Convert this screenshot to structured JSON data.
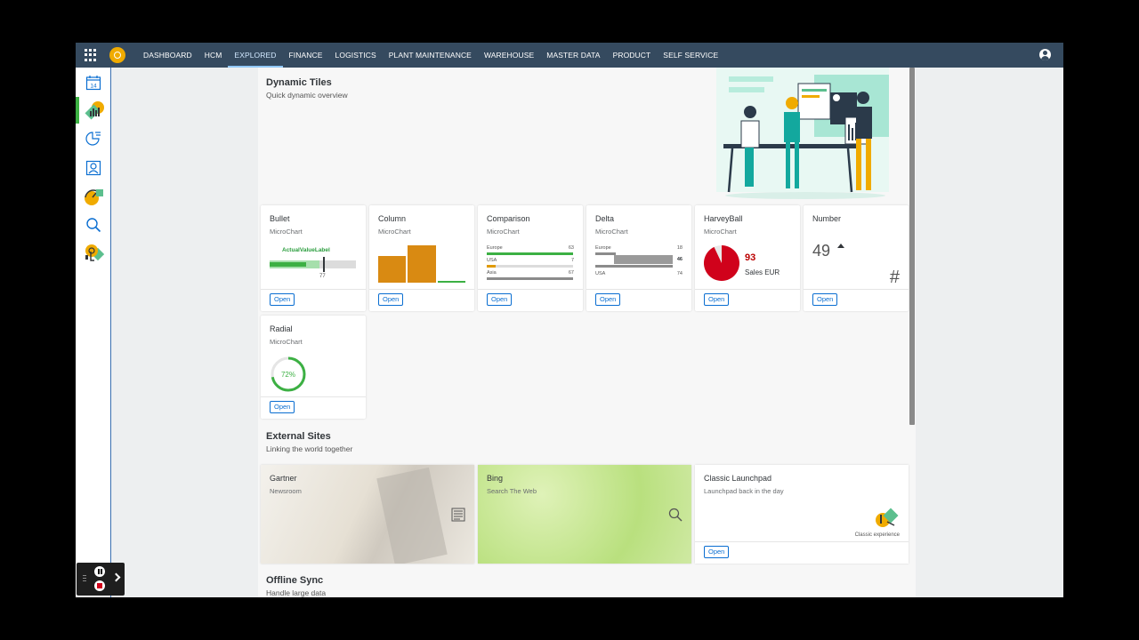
{
  "shellbar": {
    "menu": [
      "DASHBOARD",
      "HCM",
      "EXPLORED",
      "FINANCE",
      "LOGISTICS",
      "PLANT MAINTENANCE",
      "WAREHOUSE",
      "MASTER DATA",
      "PRODUCT",
      "SELF SERVICE"
    ],
    "active": "EXPLORED"
  },
  "sidenav": {
    "calendar_day": "14",
    "items": [
      "calendar-icon",
      "chart-badge-icon",
      "pie-list-icon",
      "user-card-icon",
      "gauge-icon",
      "search-icon",
      "touch-icon"
    ]
  },
  "dynamic": {
    "title": "Dynamic Tiles",
    "subtitle": "Quick dynamic overview"
  },
  "tiles": {
    "open": "Open",
    "microchart": "MicroChart",
    "bullet": {
      "title": "Bullet",
      "label": "ActualValueLabel",
      "target": "77",
      "actual_fraction": 0.42,
      "target_fraction": 0.62
    },
    "column": {
      "title": "Column"
    },
    "comparison": {
      "title": "Comparison",
      "rows": [
        {
          "label": "Europe",
          "value": "63",
          "color": "#3cb043"
        },
        {
          "label": "USA",
          "value": "7",
          "color": "#e09a00"
        },
        {
          "label": "Asia",
          "value": "67",
          "color": "#8b8b8b"
        }
      ]
    },
    "delta": {
      "title": "Delta",
      "top_label": "Europe",
      "top_value": "18",
      "delta_value": "46",
      "bottom_label": "USA",
      "bottom_value": "74"
    },
    "harveyball": {
      "title": "HarveyBall",
      "value": "93",
      "unit": "Sales EUR",
      "fraction": 0.93
    },
    "number": {
      "title": "Number",
      "value": "49",
      "symbol": "#"
    },
    "radial": {
      "title": "Radial",
      "value": "72%",
      "fraction": 0.72
    }
  },
  "external": {
    "title": "External Sites",
    "subtitle": "Linking the world together",
    "gartner": {
      "title": "Gartner",
      "sub": "Newsroom"
    },
    "bing": {
      "title": "Bing",
      "sub": "Search The Web"
    },
    "classic": {
      "title": "Classic Launchpad",
      "sub": "Launchpad back in the day",
      "caption": "Classic experience",
      "open": "Open"
    }
  },
  "offline": {
    "title": "Offline Sync",
    "subtitle": "Handle large data"
  },
  "colors": {
    "shell": "#354a5f",
    "brand": "#0a6ed1",
    "green": "#3cb043",
    "orange": "#e09a00",
    "red": "#d0021b"
  }
}
